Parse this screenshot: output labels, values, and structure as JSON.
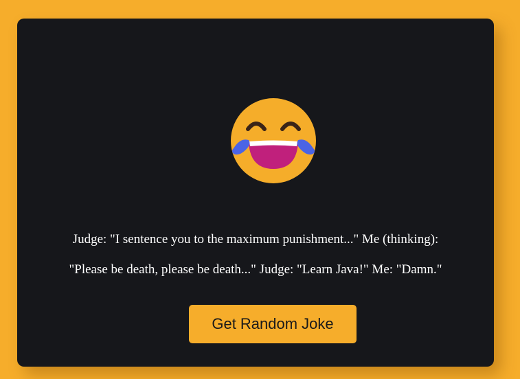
{
  "emoji": {
    "icon": "face-with-tears-of-joy-icon",
    "face_color": "#f5ad2a",
    "mouth_color": "#c0207c",
    "tear_color": "#4a64e6",
    "eye_color": "#3a2418"
  },
  "joke": {
    "line1": "Judge: \"I sentence you to the maximum punishment...\" Me (thinking):",
    "line2": "\"Please be death, please be death...\" Judge: \"Learn Java!\" Me: \"Damn.\""
  },
  "button": {
    "label": "Get Random Joke",
    "color": "#f6ad2b"
  },
  "page": {
    "background": "#f6ad2b",
    "card_background": "#16171b"
  }
}
